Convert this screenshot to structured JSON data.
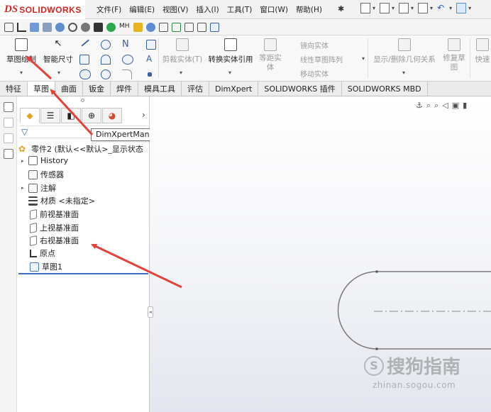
{
  "app": {
    "logo_ds": "DS",
    "logo_brand": "SOLIDWORKS"
  },
  "menu": [
    "文件(F)",
    "编辑(E)",
    "视图(V)",
    "插入(I)",
    "工具(T)",
    "窗口(W)",
    "帮助(H)"
  ],
  "ribbon": {
    "sketch_draw": "草图绘制",
    "smart_dim": "智能尺寸",
    "trim": "剪裁实体(T)",
    "convert": "转换实体引用",
    "offset": "等距实体",
    "mirror": "镜向实体",
    "linear_pattern": "线性草图阵列",
    "move": "移动实体",
    "display_delete": "显示/删除几何关系",
    "repair": "修复草图",
    "quick": "快速"
  },
  "tabs": [
    "特征",
    "草图",
    "曲面",
    "钣金",
    "焊件",
    "模具工具",
    "评估",
    "DimXpert",
    "SOLIDWORKS 插件",
    "SOLIDWORKS MBD"
  ],
  "tooltip": "DimXpertManager",
  "tree": {
    "root": "零件2 (默认<<默认>_显示状态",
    "items": [
      "History",
      "传感器",
      "注解",
      "材质 <未指定>",
      "前视基准面",
      "上视基准面",
      "右视基准面",
      "原点",
      "草图1"
    ]
  },
  "watermark": {
    "main": "搜狗指南",
    "s": "S",
    "url": "zhinan.sogou.com"
  },
  "colors": {
    "accent": "#d7261e",
    "arrow": "#e5413a",
    "selection": "#3d6fc0"
  }
}
